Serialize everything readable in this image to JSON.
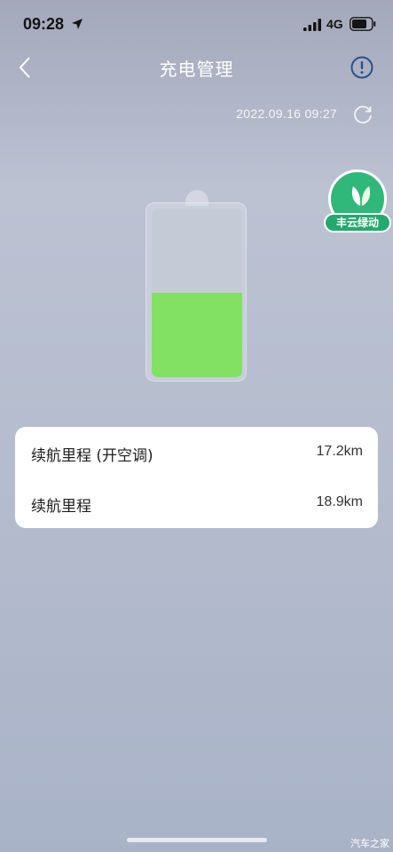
{
  "status_bar": {
    "time": "09:28",
    "network": "4G"
  },
  "header": {
    "title": "充电管理"
  },
  "update": {
    "timestamp": "2022.09.16 09:27"
  },
  "badge": {
    "label": "丰云绿动",
    "icon": "leaf-icon"
  },
  "battery": {
    "level_percent": 50,
    "fill_color": "#82e062"
  },
  "range": {
    "rows": [
      {
        "label": "续航里程 (开空调)",
        "value": "17.2km"
      },
      {
        "label": "续航里程",
        "value": "18.9km"
      }
    ]
  },
  "watermark": "汽车之家",
  "colors": {
    "badge_green": "#2fb87a",
    "battery_green": "#82e062"
  }
}
